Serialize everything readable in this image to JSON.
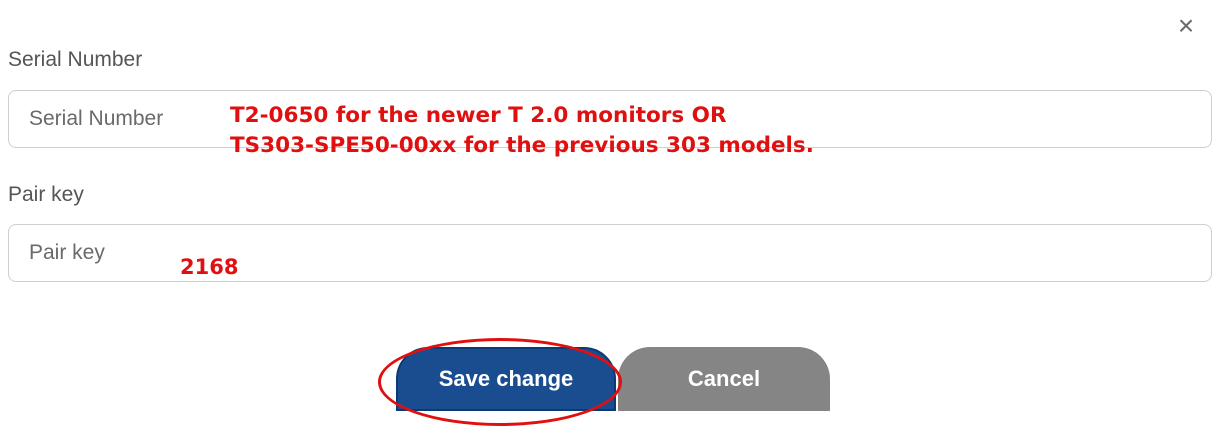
{
  "dialog": {
    "close_glyph": "×"
  },
  "serial": {
    "label": "Serial Number",
    "placeholder": "Serial Number",
    "value": "",
    "annotation_line1": "T2-0650  for the newer T 2.0 monitors OR",
    "annotation_line2": "TS303-SPE50-00xx for the previous 303 models."
  },
  "pair": {
    "label": "Pair key",
    "placeholder": "Pair key",
    "value": "",
    "annotation": "2168"
  },
  "actions": {
    "save_label": "Save change",
    "cancel_label": "Cancel"
  },
  "colors": {
    "annotation": "#e01010",
    "save_button": "#1a4d8f",
    "cancel_button": "#858585"
  }
}
